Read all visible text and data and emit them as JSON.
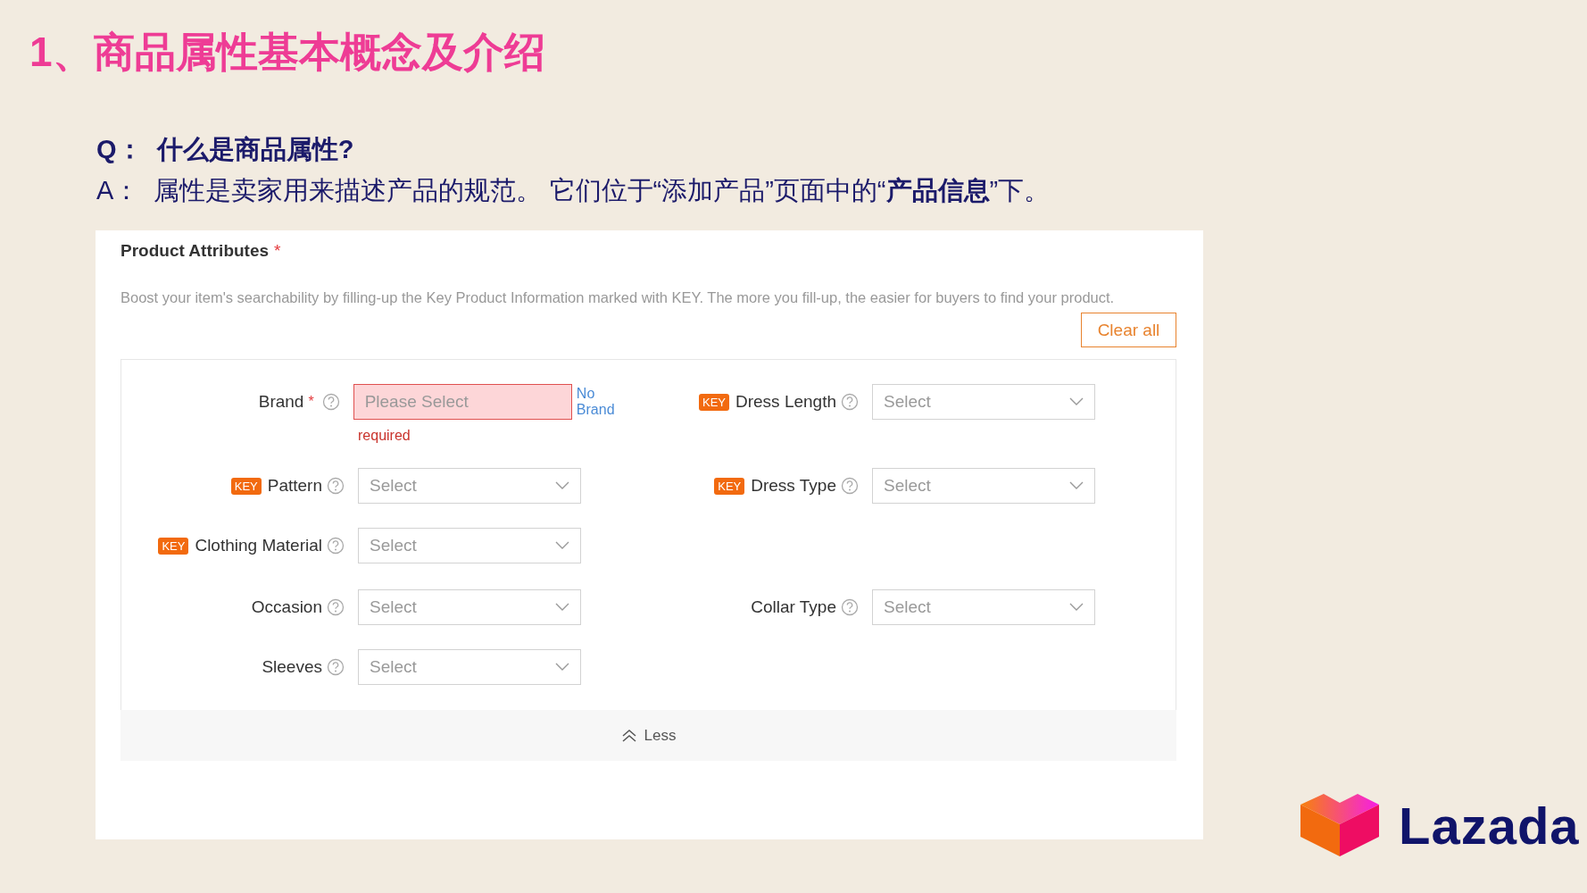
{
  "title": "1、商品属性基本概念及介绍",
  "question": "Q：  什么是商品属性?",
  "answer": "A：  属性是卖家用来描述产品的规范。 它们位于“添加产品”页面中的“**产品信息**”下。",
  "panel": {
    "heading": "Product Attributes",
    "heading_mark": "*",
    "description": "Boost your item's searchability by filling-up the Key Product Information marked with KEY. The more you fill-up, the easier for buyers to find your product.",
    "clear_button": "Clear all",
    "groups": [
      [
        {
          "left": {
            "label": "Brand",
            "required_mark": "*",
            "kind": "input",
            "placeholder": "Please Select",
            "invalid": true,
            "error": "required",
            "link": "No Brand"
          },
          "right": {
            "label": "Dress Length",
            "badge": "KEY",
            "kind": "select",
            "placeholder": "Select",
            "invalid": false
          }
        },
        {
          "left": {
            "label": "Pattern",
            "badge": "KEY",
            "kind": "select",
            "placeholder": "Select",
            "invalid": false
          },
          "right": {
            "label": "Dress Type",
            "badge": "KEY",
            "kind": "select",
            "placeholder": "Select",
            "invalid": false
          }
        },
        {
          "left": {
            "label": "Clothing Material",
            "badge": "KEY",
            "kind": "select",
            "placeholder": "Select",
            "invalid": false
          }
        }
      ],
      [
        {
          "left": {
            "label": "Occasion",
            "kind": "select",
            "placeholder": "Select",
            "invalid": false
          },
          "right": {
            "label": "Collar Type",
            "kind": "select",
            "placeholder": "Select",
            "invalid": false
          }
        },
        {
          "left": {
            "label": "Sleeves",
            "kind": "select",
            "placeholder": "Select",
            "invalid": false
          }
        }
      ]
    ],
    "toggle": "Less"
  },
  "logo": {
    "text": "Lazada"
  }
}
